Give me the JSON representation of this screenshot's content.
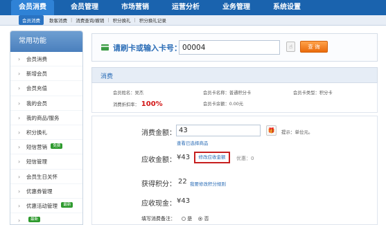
{
  "topnav": {
    "tabs": [
      "会员消费",
      "会员管理",
      "市场营销",
      "运营分析",
      "业务管理",
      "系统设置"
    ]
  },
  "subnav": {
    "active": "会员消费",
    "items": [
      "散客消费",
      "消费查询/撤销",
      "积分换礼",
      "积分换礼记录"
    ]
  },
  "sidebar": {
    "title": "常用功能",
    "items": [
      {
        "label": "会员消费"
      },
      {
        "label": "新增会员"
      },
      {
        "label": "会员充值"
      },
      {
        "label": "我的会员"
      },
      {
        "label": "我的商品/服务"
      },
      {
        "label": "积分换礼"
      },
      {
        "label": "短信营销",
        "badge": "免费"
      },
      {
        "label": "短信管理"
      },
      {
        "label": "会员生日关怀"
      },
      {
        "label": "优惠券管理"
      },
      {
        "label": "优惠活动管理",
        "badge": "最新"
      },
      {
        "label": "",
        "badge": "最新"
      }
    ]
  },
  "card_search": {
    "label": "请刷卡或输入卡号：",
    "value": "00004",
    "query_button": "查 询"
  },
  "consume": {
    "title": "消费",
    "info": {
      "member_name": "会员姓名：吴杰",
      "card_name": "会员卡名称：普通积分卡",
      "card_type": "会员卡类型：积分卡",
      "discount_label": "消费折扣率：",
      "discount_value": "100%",
      "balance": "会员卡余额：0.00元"
    },
    "form": {
      "amount_label": "消费金额：",
      "amount_value": "43",
      "tip": "提示：单位元。",
      "view_selected": "查看已选择商品",
      "receivable_label": "应收金额：",
      "receivable_value": "¥43",
      "modify_button": "修改应收金额",
      "discount_text": "优惠：0",
      "points_label": "获得积分：",
      "points_value": "22",
      "points_rule": "我要修改积分规则",
      "cash_label": "应收现金：",
      "cash_value": "¥43",
      "remark_label": "填写消费备注：",
      "remark_no": "是",
      "remark_yes": "否"
    }
  },
  "colors": {
    "nav_blue": "#1a63ae",
    "accent_orange": "#ea6b0c",
    "highlight_red": "#c61e1e",
    "discount_red": "#d21414"
  }
}
